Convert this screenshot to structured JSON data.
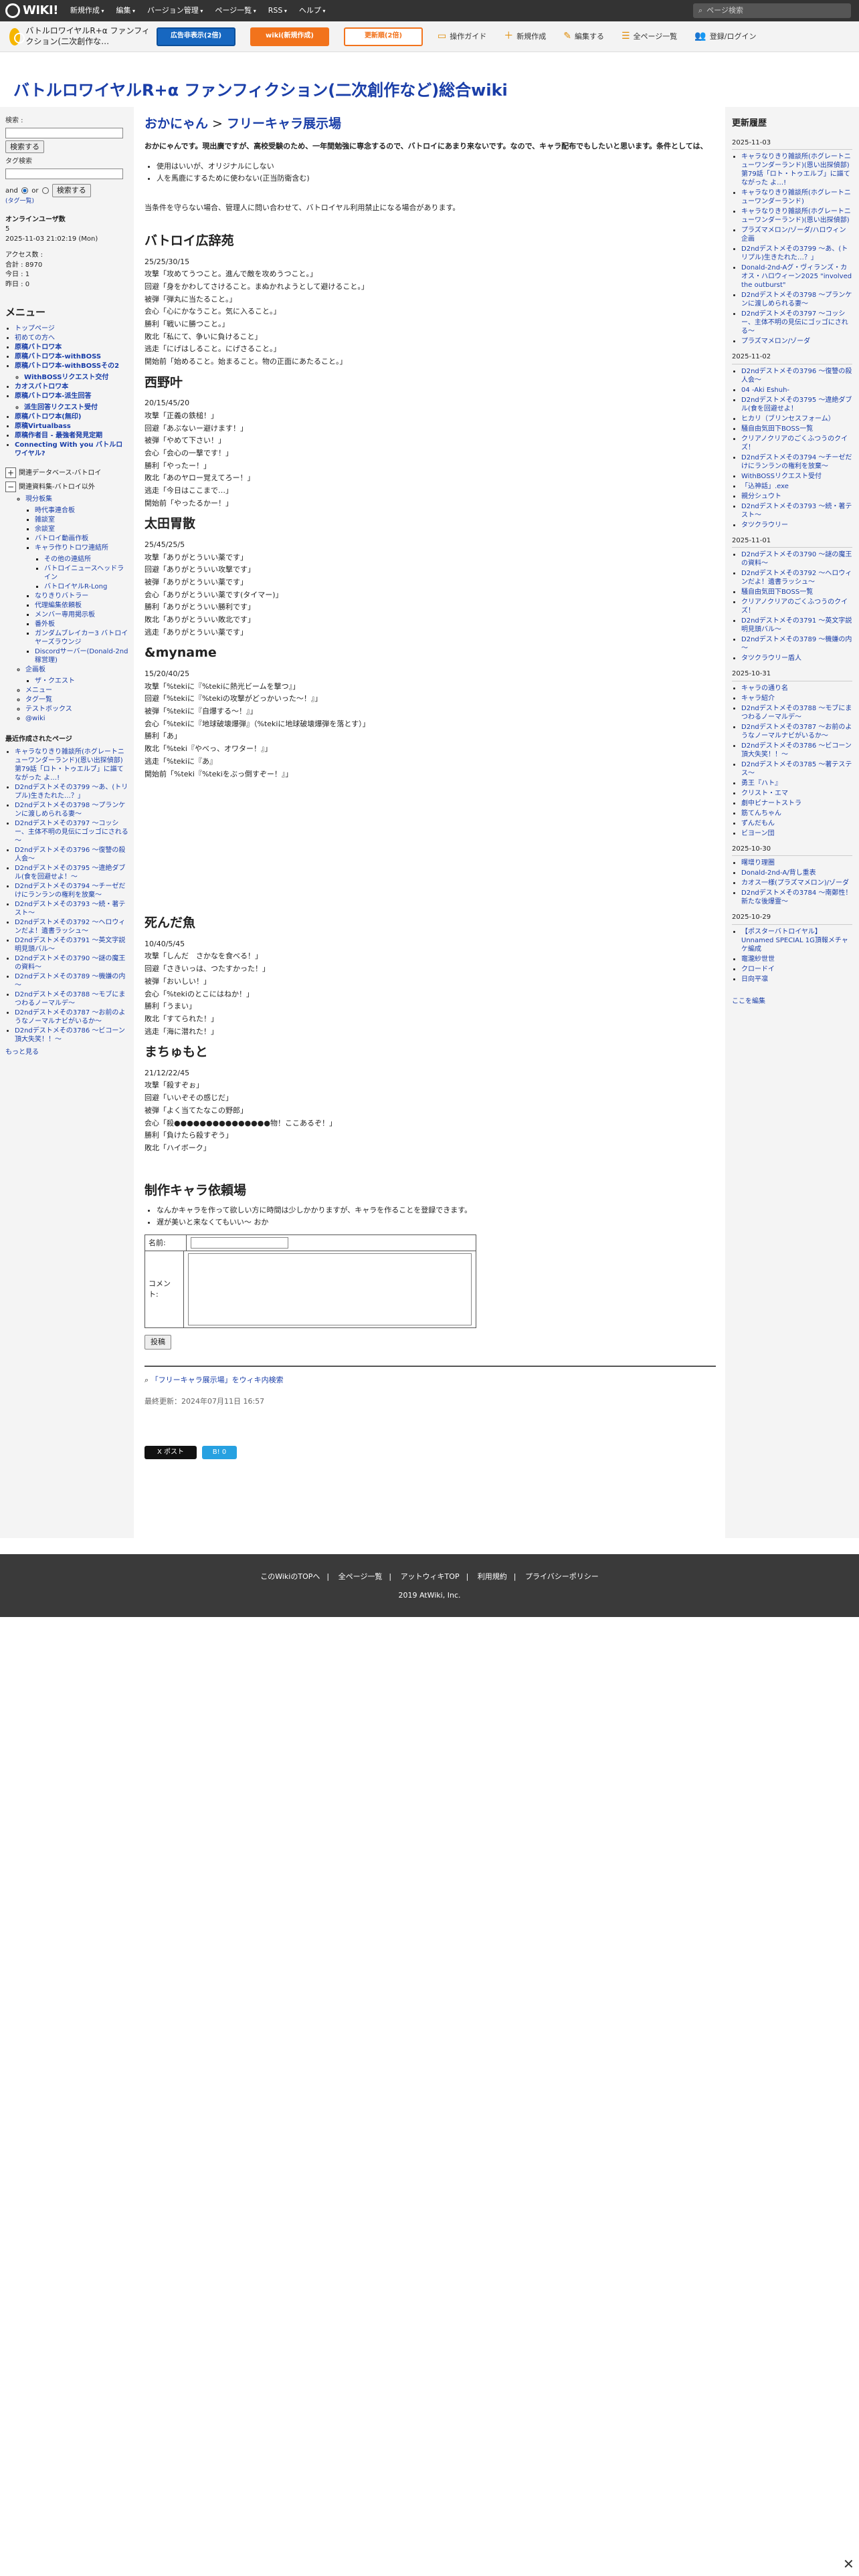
{
  "topbar": {
    "logo": "WIKI!",
    "menu": [
      "新規作成",
      "編集",
      "バージョン管理",
      "ページ一覧",
      "RSS",
      "ヘルプ"
    ],
    "search_placeholder": "ページ検索"
  },
  "secbar": {
    "wiki_name": "バトルロワイヤルR+α ファンフィクション(二次創作な…",
    "ad_button": "広告非表示(2倍)",
    "wiki_button": "wiki(新規作成)",
    "update_button": "更新順(2倍)",
    "items": [
      "操作ガイド",
      "新規作成",
      "編集する",
      "全ページ一覧",
      "登録/ログイン"
    ]
  },
  "site_title": "バトルロワイヤルR+α ファンフィクション(二次創作など)総合wiki",
  "left": {
    "search_label": "検索 :",
    "search_button": "検索する",
    "tag_label": "タグ検索",
    "and": "and",
    "or": "or",
    "tag_button": "検索する",
    "tag_cloud": "(タグ一覧)",
    "online_label": "オンラインユーザ数",
    "online_count": "5",
    "datetime": "2025-11-03 21:02:19 (Mon)",
    "access_label": "アクセス数 :",
    "total": "合計 : 8970",
    "today": "今日 : 1",
    "yesterday": "昨日 : 0",
    "menu_title": "メニュー",
    "menu_items": [
      "トップページ",
      "初めての方へ",
      "原稿バトロワ本",
      "原稿バトロワ本-withBOSS",
      "原稿バトロワ本-withBOSSその2",
      "WithBOSSリクエスト交付",
      "カオスバトロワ本",
      "原稿バトロワ本-派生回答",
      "派生回答リクエスト受付",
      "原稿バトロワ本(無印)",
      "原稿Virtualbass",
      "原稿作者目 - 最強者発見定期",
      "Connecting With you バトルロワイヤル?"
    ],
    "tree1": "関連データベース-バトロイ",
    "tree2": "関連資料集-バトロイ以外",
    "tree_root": "現分板集",
    "tree_items": [
      "時代事連合板",
      "雑談室",
      "余談室",
      "バトロイ動画作板",
      "キャラ作りトロワ連結所",
      "その他の連結所",
      "バトロイニュースヘッドライン",
      "バトロイヤルR-Long",
      "なりきりバトラー",
      "代理編集依頼板",
      "メンバー専用掲示板",
      "番外板",
      "ガンダムブレイカー3 バトロイヤーズラウンジ",
      "Discordサーバー(Donald-2nd稼営理)"
    ],
    "tree_root2": "企画板",
    "tree_items2": [
      "ザ・クエスト"
    ],
    "tail_items": [
      "メニュー",
      "タグ一覧",
      "テストボックス",
      "@wiki"
    ],
    "recent_title": "最近作成されたページ",
    "recent": [
      "キャラなりきり雑談所(ホグレートニューワンダーランド)(恩い出探偵部)第79話「ロト・トゥエルブ」に謳てながった よ…!",
      "D2ndデストメその3799 ～あ、(トリプル)生きたれた…？」",
      "D2ndデストメその3798 ～プランケンに渡しめられる妻～",
      "D2ndデストメその3797 ～コッシー、主体不明の見伝にゴッゴにされる～",
      "D2ndデストメその3796 ～復讐の殺人会～",
      "D2ndデストメその3795 ～違絶ダブル(食を回避せよ！～",
      "D2ndデストメその3794 ～チーゼだけにランランの権利を放棄～",
      "D2ndデストメその3793 ～続・著テスト～",
      "D2ndデストメその3792 ～ヘロウィンだよ！遺書ラッシュ～",
      "D2ndデストメその3791 ～英文字説明見頭バル～",
      "D2ndデストメその3790 ～謎の魔王の資料～",
      "D2ndデストメその3789 ～機嫌の内～",
      "D2ndデストメその3788 ～モブにまつわるノーマルデ～",
      "D2ndデストメその3787 ～お前のようなノーマルナビがいるか～",
      "D2ndデストメその3786 ～ビコーン頂大失笑！！～"
    ],
    "more": "もっと見る"
  },
  "main": {
    "crumb_parent": "おかにゃん",
    "crumb_sep": ">",
    "crumb_page": "フリーキャラ展示場",
    "intro": "おかにゃんです。現出廣ですが、高校受験のため、一年間勉強に専念するので、バトロイにあまり来ないです。なので、キャラ配布でもしたいと思います。条件としては、",
    "rules": [
      "使用はいいが、オリジナルにしない",
      "人を馬鹿にするために使わない(正当防衛含む)"
    ],
    "note": "当条件を守らない場合、管理人に問い合わせて、バトロイヤル利用禁止になる場合があります。",
    "chars": [
      {
        "name": "バトロイ広辞苑",
        "lines": [
          "25/25/30/15",
          "攻撃「攻めてうつこと。進んで敵を攻めうつこと。」",
          "回避「身をかわしてさけること。まぬかれようとして避けること。」",
          "被弾「弾丸に当たること。」",
          "会心「心にかなうこと。気に入ること。」",
          "勝利「戦いに勝つこと。」",
          "敗北「私にて、争いに負けること」",
          "逃走「にげはしること。にげさること。」",
          "開始前「始めること。始まること。物の正面にあたること。」"
        ]
      },
      {
        "name": "西野叶",
        "lines": [
          "20/15/45/20",
          "攻撃「正義の鉄槌！」",
          "回避「あぶないー避けます！」",
          "被弾「やめて下さい！」",
          "会心「会心の一撃です！」",
          "勝利「やったー！」",
          "敗北「あのヤロー覚えてろー！」",
          "逃走「今日はここまで…」",
          "開始前「やったるかー！」"
        ]
      },
      {
        "name": "太田胃散",
        "lines": [
          "25/45/25/5",
          "攻撃「ありがとういい薬です」",
          "回避「ありがとういい攻撃です」",
          "被弾「ありがとういい薬です」",
          "会心「ありがとういい薬です(タイマー)」",
          "勝利「ありがとういい勝利です」",
          "敗北「ありがとういい敗北です」",
          "逃走「ありがとういい薬です」"
        ]
      },
      {
        "name": "&myname",
        "lines": [
          "15/20/40/25",
          "攻撃「%tekiに『%tekiに熱光ビームを撃つ』」",
          "回避「%tekiに『%tekiの攻撃がどっかいった～！』」",
          "被弾「%tekiに『自爆する～！』」",
          "会心「%tekiに『地球破壊爆弾』（%tekiに地球破壊爆弾を落とす）」",
          "勝利「あ」",
          "敗北「%teki『やべっ、オワター！』」",
          "逃走「%tekiに『あ』",
          "開始前「%teki『%tekiをぶっ倒すぞー！』」"
        ]
      },
      {
        "name": "死んだ魚",
        "lines": [
          "10/40/5/45",
          "攻撃「しんだ　さかなを食べる！」",
          "回避「さきいっは、つたすかった！」",
          "被弾「おいしい！」",
          "会心「%tekiのとこにはねか！」",
          "勝利「うまい」",
          "敗北「すてられた！」",
          "逃走「海に潜れた！」"
        ]
      },
      {
        "name": "まちゅもと",
        "lines": [
          "21/12/22/45",
          "攻撃「殺すぞぉ」",
          "回避「いいぞその感じだ」",
          "被弾「よく当てたなこの野郎」",
          "会心「殺●●●●●●●●●●●●●●●物！ここあるぞ！」",
          "勝利「負けたら殺すぞう」",
          "敗北「ハイボーク」"
        ]
      }
    ],
    "request_title": "制作キャラ依頼場",
    "request_rules": [
      "なんかキャラを作って欲しい方に時間は少しかかりますが、キャラを作ることを登録できます。",
      "遅が美いと来なくてもいい〜 おか"
    ],
    "form_name_label": "名前:",
    "form_comment_label": "コメント:",
    "post_button": "投稿",
    "search_link": "「フリーキャラ展示場」をウィキ内検索",
    "last_modified": "最終更新：2024年07月11日 16:57",
    "share_x": "X ポスト",
    "share_b": "B! 0"
  },
  "right": {
    "title": "更新履歴",
    "groups": [
      {
        "date": "2025-11-03",
        "items": [
          "キャラなりきり雑談所(ホグレートニューワンダーランド)(恩い出探偵部)第79話「ロト・トゥエルブ」に謳てながった よ…!",
          "キャラなりきり雑談所(ホグレートニューワンダーランド)",
          "キャラなりきり雑談所(ホグレートニューワンダーランド)(恩い出探偵部)",
          "プラズマメロン/ゾーダ/ハロウィン企画",
          "D2ndデストメその3799 ～あ、(トリプル)生きたれた…？」",
          "Donald-2nd-Aグ・ヴィランズ・カオス・ハロウィーン2025 \"involved the outburst\"",
          "D2ndデストメその3798 ～プランケンに渡しめられる妻～",
          "D2ndデストメその3797 ～コッシー、主体不明の見伝にゴッゴにされる～",
          "プラズマメロン/ゾーダ"
        ]
      },
      {
        "date": "2025-11-02",
        "items": [
          "D2ndデストメその3796 ～復讐の殺人会～",
          "04 -Aki Eshuh-",
          "D2ndデストメその3795 ～違絶ダブル(食を回避せよ！",
          "ヒカリ（ブリンセスフォーム）",
          "騒自由気田下BOSS一覧",
          "クリアノクリアのごくふつうのクイズ！",
          "D2ndデストメその3794 ～チーゼだけにランランの権利を放棄～",
          "WithBOSSリクエスト受付",
          "「込神話」.exe",
          "親分シュウト",
          "D2ndデストメその3793 ～続・著テスト～",
          "タツクラウリー"
        ]
      },
      {
        "date": "2025-11-01",
        "items": [
          "D2ndデストメその3790 ～謎の魔王の資料～",
          "D2ndデストメその3792 ～ヘロウィンだよ！遺書ラッシュ～",
          "騒自由気田下BOSS一覧",
          "クリアノクリアのごくふつうのクイズ！",
          "D2ndデストメその3791 ～英文字説明見頭バル～",
          "D2ndデストメその3789 ～機嫌の内～",
          "タツクラウリー盾人"
        ]
      },
      {
        "date": "2025-10-31",
        "items": [
          "キャラの通り名",
          "キャラ紹介",
          "D2ndデストメその3788 ～モブにまつわるノーマルデ～",
          "D2ndデストメその3787 ～お前のようなノーマルナビがいるか～",
          "D2ndデストメその3786 ～ビコーン頂大失笑！！～",
          "D2ndデストメその3785 ～著テステス～",
          "勇王『ハト』",
          "クリスト・エマ",
          "劇中ビナートストラ",
          "筋てんちゃん",
          "ずんだもん",
          "ビヨーン団"
        ]
      },
      {
        "date": "2025-10-30",
        "items": [
          "曙增り理圏",
          "Donald-2nd-A/背し重表",
          "カオス一様(プラズマメロン)/ゾーダ",
          "D2ndデストメその3784 ～南鄭性！新たな後爆霊～"
        ]
      },
      {
        "date": "2025-10-29",
        "items": [
          "【ポスターバトロイヤル】Unnamed SPECIAL 1G頂報メチャケ編成",
          "竈瀧紗世世",
          "クロードイ",
          "日向平凛"
        ]
      }
    ],
    "edit": "ここを編集"
  },
  "footer": {
    "links": [
      "このWikiのTOPへ",
      "全ページ一覧",
      "アットウィキTOP",
      "利用規約",
      "プライバシーポリシー"
    ],
    "copyright": "2019 AtWiki, Inc."
  },
  "close": "✕"
}
